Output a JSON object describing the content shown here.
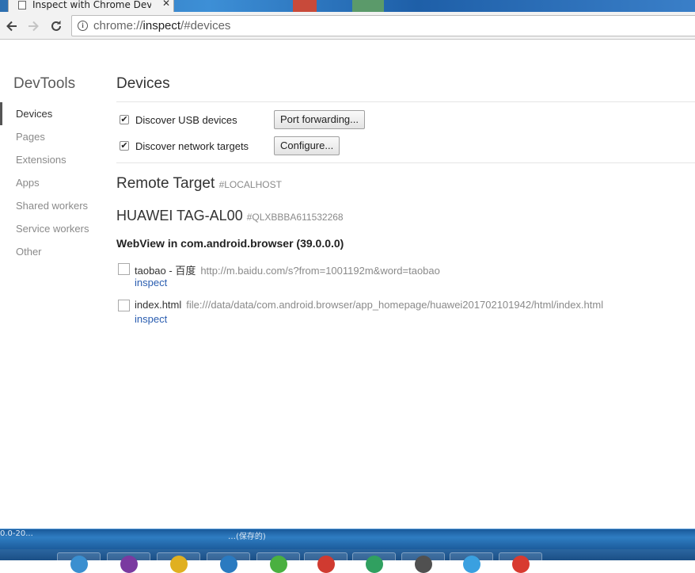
{
  "window": {
    "tab_title": "Inspect with Chrome Developer Tools",
    "tab_close": "✕"
  },
  "toolbar": {
    "back_icon": "arrow-left-icon",
    "forward_icon": "arrow-right-icon",
    "reload_icon": "reload-icon",
    "url_scheme": "chrome://",
    "url_host": "inspect",
    "url_path": "/#devices"
  },
  "sidebar": {
    "title": "DevTools",
    "items": [
      {
        "label": "Devices",
        "active": true
      },
      {
        "label": "Pages"
      },
      {
        "label": "Extensions"
      },
      {
        "label": "Apps"
      },
      {
        "label": "Shared workers"
      },
      {
        "label": "Service workers"
      },
      {
        "label": "Other"
      }
    ]
  },
  "main": {
    "title": "Devices",
    "options": [
      {
        "label": "Discover USB devices",
        "checked": true,
        "button": "Port forwarding..."
      },
      {
        "label": "Discover network targets",
        "checked": true,
        "button": "Configure..."
      }
    ],
    "remote_target": {
      "title": "Remote Target",
      "sub": "#LOCALHOST"
    },
    "device": {
      "name": "HUAWEI TAG-AL00",
      "serial": "#QLXBBBA611532268"
    },
    "browser": "WebView in com.android.browser (39.0.0.0)",
    "targets": [
      {
        "name": "taobao - 百度",
        "url": "http://m.baidu.com/s?from=1001192m&word=taobao",
        "action": "inspect"
      },
      {
        "name": "index.html",
        "url": "file:///data/data/com.android.browser/app_homepage/huawei201702101942/html/index.html",
        "action": "inspect"
      }
    ]
  },
  "taskbar": {
    "left_text": "0.0-20...",
    "mid_text": "…(保存的)"
  },
  "colors": {
    "link": "#2a5db0",
    "taskbar": "#1c5c9c"
  }
}
